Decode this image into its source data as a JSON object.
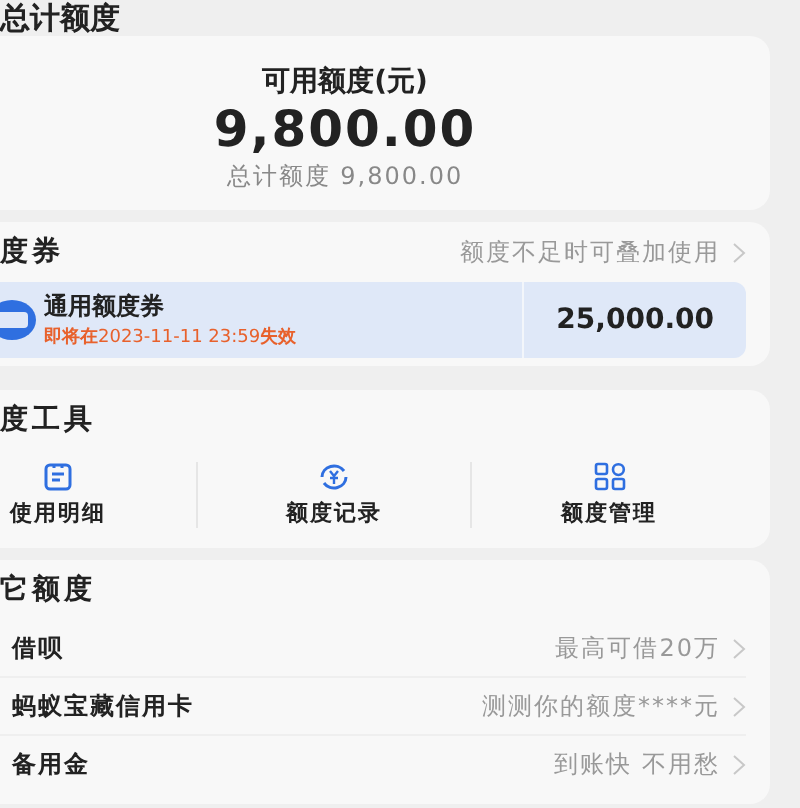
{
  "header": {
    "title": "总计额度"
  },
  "balance": {
    "label": "可用额度(元)",
    "amount": "9,800.00",
    "total": "总计额度 9,800.00"
  },
  "coupons": {
    "title": "度券",
    "hint": "额度不足时可叠加使用",
    "items": [
      {
        "name": "通用额度券",
        "expiry_prefix": "即将在",
        "expiry_date": "2023-11-11 23:59",
        "expiry_suffix": "失效",
        "amount": "25,000.00"
      }
    ]
  },
  "tools": {
    "title": "度工具",
    "items": [
      {
        "kind": "detail",
        "label": "使用明细"
      },
      {
        "kind": "record",
        "label": "额度记录"
      },
      {
        "kind": "manage",
        "label": "额度管理"
      }
    ]
  },
  "other": {
    "title": "它额度",
    "items": [
      {
        "name": "借呗",
        "hint": "最高可借20万"
      },
      {
        "name": "蚂蚁宝藏信用卡",
        "hint": "测测你的额度****元"
      },
      {
        "name": "备用金",
        "hint": "到账快 不用愁"
      }
    ]
  }
}
